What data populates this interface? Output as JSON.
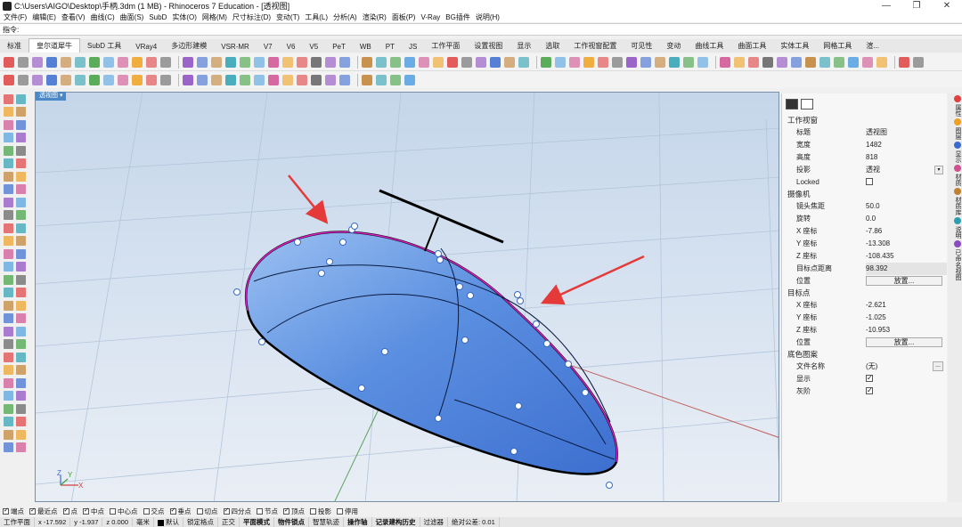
{
  "window": {
    "title": "C:\\Users\\AIGO\\Desktop\\手柄.3dm (1 MB) - Rhinoceros 7 Education - [透视图]",
    "minimize": "—",
    "maximize": "❐",
    "close": "✕"
  },
  "menu": [
    "文件(F)",
    "编辑(E)",
    "查看(V)",
    "曲线(C)",
    "曲面(S)",
    "SubD",
    "实体(O)",
    "网格(M)",
    "尺寸标注(D)",
    "变动(T)",
    "工具(L)",
    "分析(A)",
    "渲染(R)",
    "面板(P)",
    "V-Ray",
    "BG插件",
    "说明(H)"
  ],
  "command": {
    "prompt": "指令:"
  },
  "tabs": [
    "标准",
    "皇尔道犀牛",
    "SubD 工具",
    "VRay4",
    "多边形建模",
    "VSR-MR",
    "V7",
    "V6",
    "V5",
    "PeT",
    "WB",
    "PT",
    "JS",
    "工作平面",
    "设置视图",
    "显示",
    "选取",
    "工作视窗配置",
    "可见性",
    "变动",
    "曲线工具",
    "曲面工具",
    "实体工具",
    "网格工具",
    "渲..."
  ],
  "active_tab_index": 1,
  "viewport": {
    "label": "透视图 ▾",
    "axes": {
      "x": "X",
      "y": "Y",
      "z": "Z"
    }
  },
  "colors": {
    "accent": "#4a88c7",
    "surface_fill": "#5b8fe0",
    "edge": "#000000",
    "highlight": "#e020c8",
    "arrow": "#e53a3a",
    "grid": "#b0c4dc",
    "x_axis": "#c0605c",
    "y_axis": "#5ca05c"
  },
  "properties": {
    "section_viewport": "工作视窗",
    "viewport_rows": [
      {
        "label": "标题",
        "value": "透视图"
      },
      {
        "label": "宽度",
        "value": "1482"
      },
      {
        "label": "高度",
        "value": "818"
      },
      {
        "label": "投影",
        "value": "透视"
      },
      {
        "label": "Locked",
        "value": ""
      }
    ],
    "section_camera": "摄像机",
    "camera_rows": [
      {
        "label": "镜头焦距",
        "value": "50.0"
      },
      {
        "label": "旋转",
        "value": "0.0"
      },
      {
        "label": "X 座标",
        "value": "-7.86"
      },
      {
        "label": "Y 座标",
        "value": "-13.308"
      },
      {
        "label": "Z 座标",
        "value": "-108.435"
      },
      {
        "label": "目标点距离",
        "value": "98.392"
      },
      {
        "label": "位置",
        "value": "放置..."
      }
    ],
    "section_target": "目标点",
    "target_rows": [
      {
        "label": "X 座标",
        "value": "-2.621"
      },
      {
        "label": "Y 座标",
        "value": "-1.025"
      },
      {
        "label": "Z 座标",
        "value": "-10.953"
      },
      {
        "label": "位置",
        "value": "放置..."
      }
    ],
    "section_wallpaper": "底色图案",
    "wallpaper_rows": [
      {
        "label": "文件名称",
        "value": "(无)"
      },
      {
        "label": "显示",
        "value": ""
      },
      {
        "label": "灰阶",
        "value": ""
      }
    ]
  },
  "side_tabs": [
    "属性",
    "图层",
    "显示",
    "材质",
    "材质库",
    "说明",
    "已命名视图"
  ],
  "osnaps": [
    {
      "label": "端点",
      "checked": true
    },
    {
      "label": "最近点",
      "checked": true
    },
    {
      "label": "点",
      "checked": true
    },
    {
      "label": "中点",
      "checked": true
    },
    {
      "label": "中心点",
      "checked": false
    },
    {
      "label": "交点",
      "checked": false
    },
    {
      "label": "垂点",
      "checked": true
    },
    {
      "label": "切点",
      "checked": false
    },
    {
      "label": "四分点",
      "checked": true
    },
    {
      "label": "节点",
      "checked": false
    },
    {
      "label": "顶点",
      "checked": true
    },
    {
      "label": "投影",
      "checked": false
    },
    {
      "label": "停用",
      "checked": false
    }
  ],
  "status": {
    "cplane": "工作平面",
    "x": "x -17.592",
    "y": "y -1.937",
    "z": "z 0.000",
    "units": "毫米",
    "layer": "默认",
    "toggles": [
      "锁定格点",
      "正交",
      "平面模式",
      "物件锁点",
      "智慧轨迹",
      "操作轴",
      "记录建构历史",
      "过滤器"
    ],
    "bold_toggles": [
      "平面模式",
      "物件锁点",
      "操作轴",
      "记录建构历史"
    ],
    "tolerance": "绝对公差: 0.01"
  }
}
